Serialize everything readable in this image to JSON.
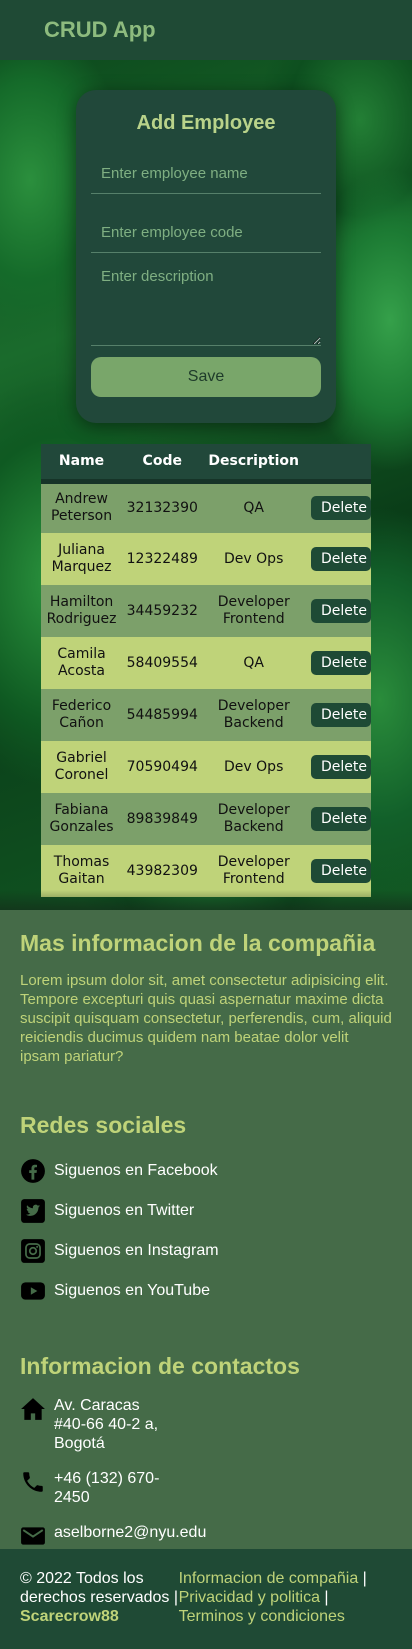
{
  "navbar": {
    "brand": "CRUD App"
  },
  "form": {
    "title": "Add Employee",
    "name_placeholder": "Enter employee name",
    "code_placeholder": "Enter employee code",
    "description_placeholder": "Enter description",
    "save_label": "Save"
  },
  "table": {
    "headers": [
      "Name",
      "Code",
      "Description",
      ""
    ],
    "delete_label": "Delete",
    "rows": [
      {
        "name": "Andrew Peterson",
        "code": "32132390",
        "description": "QA"
      },
      {
        "name": "Juliana Marquez",
        "code": "12322489",
        "description": "Dev Ops"
      },
      {
        "name": "Hamilton Rodriguez",
        "code": "34459232",
        "description": "Developer Frontend"
      },
      {
        "name": "Camila Acosta",
        "code": "58409554",
        "description": "QA"
      },
      {
        "name": "Federico Cañon",
        "code": "54485994",
        "description": "Developer Backend"
      },
      {
        "name": "Gabriel Coronel",
        "code": "70590494",
        "description": "Dev Ops"
      },
      {
        "name": "Fabiana Gonzales",
        "code": "89839849",
        "description": "Developer Backend"
      },
      {
        "name": "Thomas Gaitan",
        "code": "43982309",
        "description": "Developer Frontend"
      }
    ]
  },
  "about": {
    "title": "Mas informacion de la compañia",
    "text": "Lorem ipsum dolor sit, amet consectetur adipisicing elit. Tempore excepturi quis quasi aspernatur maxime dicta suscipit quisquam consectetur, perferendis, cum, aliquid reiciendis ducimus quidem nam beatae dolor velit ipsam pariatur?"
  },
  "social": {
    "title": "Redes sociales",
    "items": [
      {
        "label": "Siguenos en Facebook",
        "icon": "facebook-icon"
      },
      {
        "label": "Siguenos en Twitter",
        "icon": "twitter-icon"
      },
      {
        "label": "Siguenos en Instagram",
        "icon": "instagram-icon"
      },
      {
        "label": "Siguenos en YouTube",
        "icon": "youtube-icon"
      }
    ]
  },
  "contact": {
    "title": "Informacion de contactos",
    "address": "Av. Caracas #40-66 40-2 a, Bogotá",
    "phone": "+46 (132) 670-2450",
    "email": "aselborne2@nyu.edu"
  },
  "footer": {
    "copyright": "© 2022 Todos los derechos reservados |",
    "author": "Scarecrow88",
    "links": [
      "Informacion de compañia",
      "Privacidad y politica",
      "Terminos y condiciones"
    ]
  },
  "colors": {
    "navbar": "#1f4a35",
    "accent": "#bfd379",
    "page_bg": "#456b48",
    "row_odd": "#7ca06a",
    "row_even": "#bfd379"
  }
}
